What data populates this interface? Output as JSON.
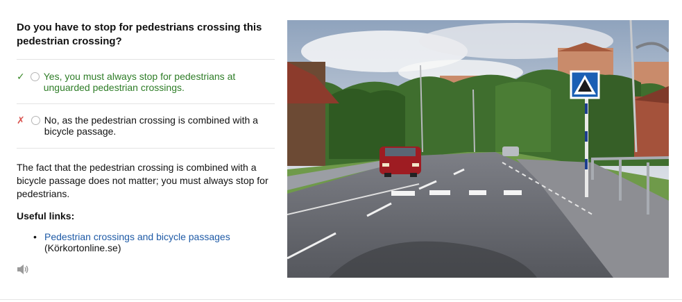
{
  "question": "Do you have to stop for pedestrians crossing this pedestrian crossing?",
  "answers": [
    {
      "mark": "✓",
      "text": "Yes, you must always stop for pedestrians at unguarded pedestrian crossings.",
      "status": "correct"
    },
    {
      "mark": "✗",
      "text": "No, as the pedestrian crossing is combined with a bicycle passage.",
      "status": "wrong"
    }
  ],
  "explanation": "The fact that the pedestrian crossing is combined with a bicycle passage does not matter; you must always stop for pedestrians.",
  "useful_links": {
    "heading": "Useful links:",
    "items": [
      {
        "label": "Pedestrian crossings and bicycle passages",
        "source": "(Körkortonline.se)"
      }
    ]
  },
  "icons": {
    "audio": "speaker-icon"
  },
  "colors": {
    "correct": "#2e7d27",
    "wrong": "#d9534f",
    "link": "#1e5aa6"
  }
}
